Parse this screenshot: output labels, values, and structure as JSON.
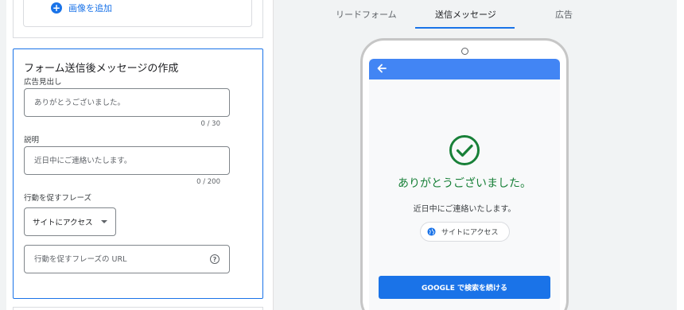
{
  "left": {
    "add_image_label": "画像を追加",
    "section_title": "フォーム送信後メッセージの作成",
    "headline": {
      "label": "広告見出し",
      "placeholder": "ありがとうございました。",
      "counter": "0 / 30"
    },
    "description": {
      "label": "説明",
      "placeholder": "近日中にご連絡いたします。",
      "counter": "0 / 200"
    },
    "cta": {
      "label": "行動を促すフレーズ",
      "selected": "サイトにアクセス",
      "url_placeholder": "行動を促すフレーズの URL"
    }
  },
  "tabs": [
    {
      "label": "リードフォーム",
      "active": false
    },
    {
      "label": "送信メッセージ",
      "active": true
    },
    {
      "label": "広告",
      "active": false
    }
  ],
  "preview": {
    "thanks_text": "ありがとうございました。",
    "desc_text": "近日中にご連絡いたします。",
    "chip_label": "サイトにアクセス",
    "google_button": "GOOGLE で検索を続ける"
  },
  "colors": {
    "accent": "#1a73e8",
    "header_bar": "#4285f4",
    "success": "#188038"
  }
}
